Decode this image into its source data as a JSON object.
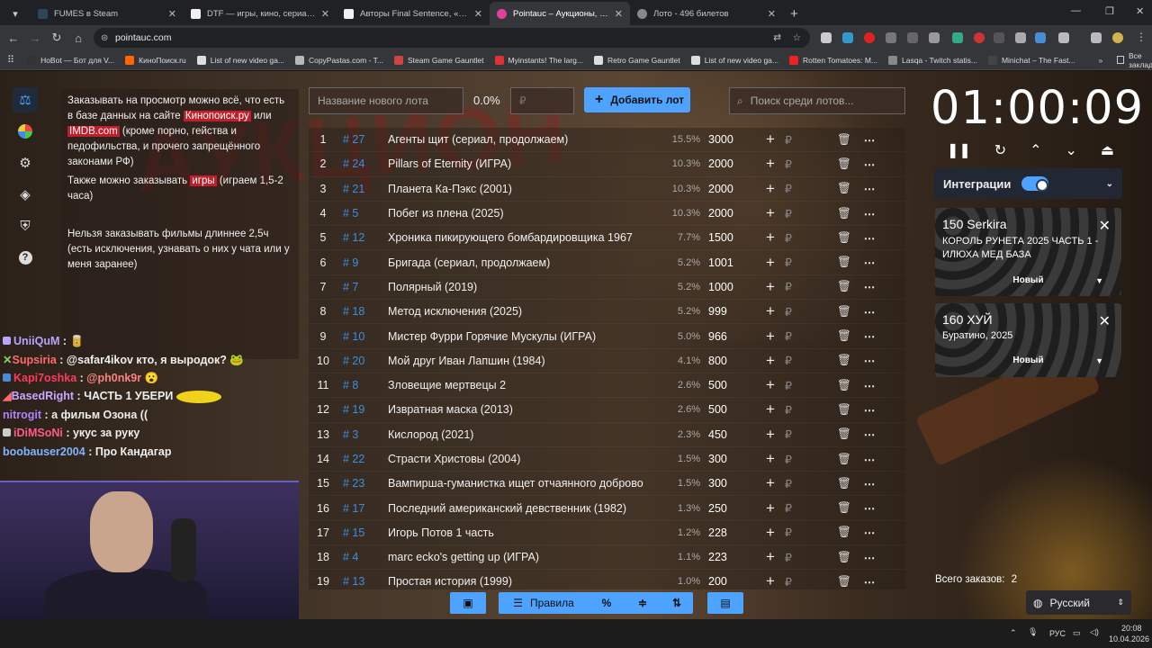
{
  "browser": {
    "tabs": [
      {
        "title": "FUMES в Steam",
        "color": "#2a475e"
      },
      {
        "title": "DTF — игры, кино, сериалы, р",
        "color": "#f0f0f0"
      },
      {
        "title": "Авторы Final Sentence, «батл",
        "color": "#f0f0f0"
      },
      {
        "title": "Pointauc – Аукционы, лотере",
        "color": "#e0409a"
      },
      {
        "title": "Лото - 496 билетов",
        "color": "#888"
      }
    ],
    "url": "pointauc.com",
    "bookmarks": [
      {
        "label": "HoBot — Бот для V...",
        "color": "#333"
      },
      {
        "label": "КиноПоиск.ru",
        "color": "#ff6600"
      },
      {
        "label": "List of new video ga...",
        "color": "#ddd"
      },
      {
        "label": "CopyPastas.com - T...",
        "color": "#b8b8b8"
      },
      {
        "label": "Steam Game Gauntlet",
        "color": "#c44"
      },
      {
        "label": "Myinstants! The larg...",
        "color": "#d33"
      },
      {
        "label": "Retro Game Gauntlet",
        "color": "#ddd"
      },
      {
        "label": "List of new video ga...",
        "color": "#ddd"
      },
      {
        "label": "Rotten Tomatoes: M...",
        "color": "#e22"
      },
      {
        "label": "Lasqa - Twitch statis...",
        "color": "#888"
      },
      {
        "label": "Minichat – The Fast...",
        "color": "#444"
      }
    ],
    "all_bookmarks": "Все закладки"
  },
  "rules": {
    "p1_a": "Заказывать на просмотр можно всё, что есть в базе данных на сайте ",
    "p1_link1": "Кинопоиск.ру",
    "p1_b": " или ",
    "p1_link2": "IMDB.com",
    "p1_c": " (кроме порно, гейства и педофильства, и прочего запрещённого законами РФ)",
    "p2_a": "Также можно заказывать ",
    "p2_link": "игры",
    "p2_b": " (играем 1,5-2 часа)",
    "p3": "Нельзя заказывать фильмы длиннее 2,5ч (есть исключения, узнавать о них у чата или у меня заранее)"
  },
  "chat": [
    {
      "user": "UniiQuM",
      "sep": " : ",
      "msg": "",
      "color": "#b7a4ff",
      "emote": "🥫"
    },
    {
      "user": "Supsiria",
      "sep": " : ",
      "msg": "@safar4ikov кто, я выродок?",
      "color": "#ff6b6b",
      "mention": true,
      "emote": "🐸"
    },
    {
      "user": "Kapi7oshka",
      "sep": " : ",
      "msg": "@ph0nk9r",
      "color": "#ff3b5b",
      "mention": true,
      "emote": "😮"
    },
    {
      "user": "BasedRight",
      "sep": " : ",
      "msg": "ЧАСТЬ 1 УБЕРИ",
      "color": "#c9a6ff",
      "emote": "🟡"
    },
    {
      "user": "nitrogit",
      "sep": " : ",
      "msg": "а фильм Озона ((",
      "color": "#b67fff"
    },
    {
      "user": "iDiMSoNi",
      "sep": " : ",
      "msg": "укус за руку",
      "color": "#ff5a8a"
    },
    {
      "user": "boobauser2004",
      "sep": " : ",
      "msg": "Про Кандагар",
      "color": "#7fb6ff"
    }
  ],
  "lot_input": {
    "placeholder": "Название нового лота",
    "percent": "0.0%",
    "sum_placeholder": "₽"
  },
  "add_button": "Добавить лот",
  "search": {
    "placeholder": "Поиск среди лотов..."
  },
  "lots": [
    {
      "n": "1",
      "id": "# 27",
      "name": "Агенты щит (сериал, продолжаем)",
      "pct": "15.5%",
      "val": "3000"
    },
    {
      "n": "2",
      "id": "# 24",
      "name": "Pillars of Eternity (ИГРА)",
      "pct": "10.3%",
      "val": "2000"
    },
    {
      "n": "3",
      "id": "# 21",
      "name": "Планета Ка-Пэкс (2001)",
      "pct": "10.3%",
      "val": "2000"
    },
    {
      "n": "4",
      "id": "# 5",
      "name": "Побег из плена (2025)",
      "pct": "10.3%",
      "val": "2000"
    },
    {
      "n": "5",
      "id": "# 12",
      "name": "Хроника пикирующего бомбардировщика 1967",
      "pct": "7.7%",
      "val": "1500"
    },
    {
      "n": "6",
      "id": "# 9",
      "name": "Бригада (сериал, продолжаем)",
      "pct": "5.2%",
      "val": "1001"
    },
    {
      "n": "7",
      "id": "# 7",
      "name": "Полярный (2019)",
      "pct": "5.2%",
      "val": "1000"
    },
    {
      "n": "8",
      "id": "# 18",
      "name": "Метод исключения (2025)",
      "pct": "5.2%",
      "val": "999"
    },
    {
      "n": "9",
      "id": "# 10",
      "name": "Мистер Фурри Горячие Мускулы (ИГРА)",
      "pct": "5.0%",
      "val": "966"
    },
    {
      "n": "10",
      "id": "# 20",
      "name": "Мой друг Иван Лапшин (1984)",
      "pct": "4.1%",
      "val": "800"
    },
    {
      "n": "11",
      "id": "# 8",
      "name": "Зловещие мертвецы 2",
      "pct": "2.6%",
      "val": "500"
    },
    {
      "n": "12",
      "id": "# 19",
      "name": "Извратная маска (2013)",
      "pct": "2.6%",
      "val": "500"
    },
    {
      "n": "13",
      "id": "# 3",
      "name": "Кислород (2021)",
      "pct": "2.3%",
      "val": "450"
    },
    {
      "n": "14",
      "id": "# 22",
      "name": "Страсти Христовы (2004)",
      "pct": "1.5%",
      "val": "300"
    },
    {
      "n": "15",
      "id": "# 23",
      "name": "Вампирша-гуманистка ищет отчаянного доброво",
      "pct": "1.5%",
      "val": "300"
    },
    {
      "n": "16",
      "id": "# 17",
      "name": "Последний американский девственник (1982)",
      "pct": "1.3%",
      "val": "250"
    },
    {
      "n": "17",
      "id": "# 15",
      "name": "Игорь Потов 1 часть",
      "pct": "1.2%",
      "val": "228"
    },
    {
      "n": "18",
      "id": "# 4",
      "name": "marc ecko's getting up (ИГРА)",
      "pct": "1.1%",
      "val": "223"
    },
    {
      "n": "19",
      "id": "# 13",
      "name": "Простая история (1999)",
      "pct": "1.0%",
      "val": "200"
    }
  ],
  "bottom": {
    "rules_label": "Правила"
  },
  "timer": "01:00:09",
  "integrations": {
    "label": "Интеграции"
  },
  "orders": [
    {
      "amount": "150 Serkira",
      "text": "КОРОЛЬ РУНЕТА 2025 ЧАСТЬ 1 - ИЛЮХА МЕД БАЗА",
      "status": "Новый"
    },
    {
      "amount": "160 ХУЙ",
      "text": "Буратино, 2025",
      "status": "Новый"
    }
  ],
  "total_orders": {
    "label": "Всего заказов:",
    "value": "2"
  },
  "language": "Русский",
  "taskbar": {
    "lang": "РУС",
    "time": "20:08",
    "date": "10.04.2026"
  },
  "colors": {
    "accent": "#4da3ff",
    "link_highlight": "#c21d2a",
    "hash": "#3d8ee0"
  }
}
